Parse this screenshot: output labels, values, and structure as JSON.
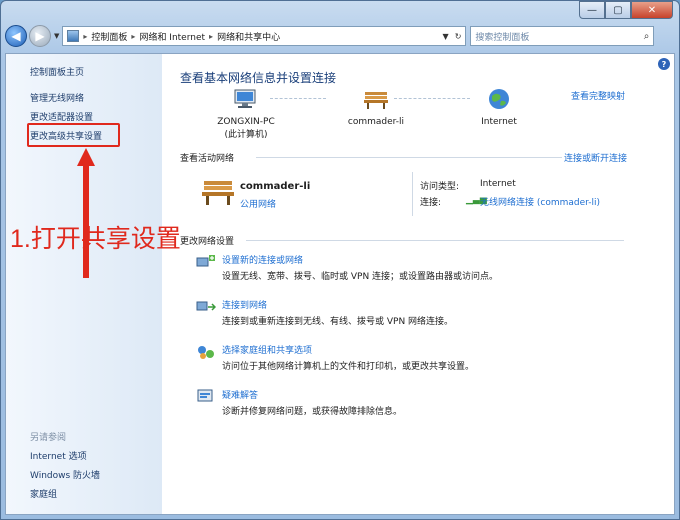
{
  "window": {
    "controls": {
      "minimize": "—",
      "maximize": "▢",
      "close": "✕"
    }
  },
  "addressbar": {
    "crumbs": [
      "控制面板",
      "网络和 Internet",
      "网络和共享中心"
    ],
    "search_placeholder": "搜索控制面板"
  },
  "sidebar": {
    "home": "控制面板主页",
    "links": [
      "管理无线网络",
      "更改适配器设置",
      "更改高级共享设置"
    ],
    "see_also_heading": "另请参阅",
    "see_also": [
      "Internet 选项",
      "Windows 防火墙",
      "家庭组"
    ]
  },
  "annotation": {
    "text": "1.打开共享设置",
    "color": "#e0291d"
  },
  "main": {
    "title": "查看基本网络信息并设置连接",
    "full_map_link": "查看完整映射",
    "map_nodes": [
      {
        "label": "ZONGXIN-PC",
        "sublabel": "(此计算机)",
        "icon": "computer-icon"
      },
      {
        "label": "commader-li",
        "sublabel": "",
        "icon": "bench-icon"
      },
      {
        "label": "Internet",
        "sublabel": "",
        "icon": "globe-icon"
      }
    ],
    "active_networks_label": "查看活动网络",
    "connect_disconnect_link": "连接或断开连接",
    "network": {
      "name": "commader-li",
      "type": "公用网络",
      "access_type_label": "访问类型:",
      "access_type_value": "Internet",
      "connections_label": "连接:",
      "connections_value": "无线网络连接 (commader-li)"
    },
    "change_settings_label": "更改网络设置",
    "tasks": [
      {
        "title": "设置新的连接或网络",
        "desc": "设置无线、宽带、拨号、临时或 VPN 连接；或设置路由器或访问点。",
        "icon": "new-connection-icon"
      },
      {
        "title": "连接到网络",
        "desc": "连接到或重新连接到无线、有线、拨号或 VPN 网络连接。",
        "icon": "connect-network-icon"
      },
      {
        "title": "选择家庭组和共享选项",
        "desc": "访问位于其他网络计算机上的文件和打印机，或更改共享设置。",
        "icon": "homegroup-icon"
      },
      {
        "title": "疑难解答",
        "desc": "诊断并修复网络问题，或获得故障排除信息。",
        "icon": "troubleshoot-icon"
      }
    ]
  },
  "colors": {
    "link": "#1f6fd1",
    "title": "#1a3f7a",
    "annotation_red": "#e0291d"
  }
}
